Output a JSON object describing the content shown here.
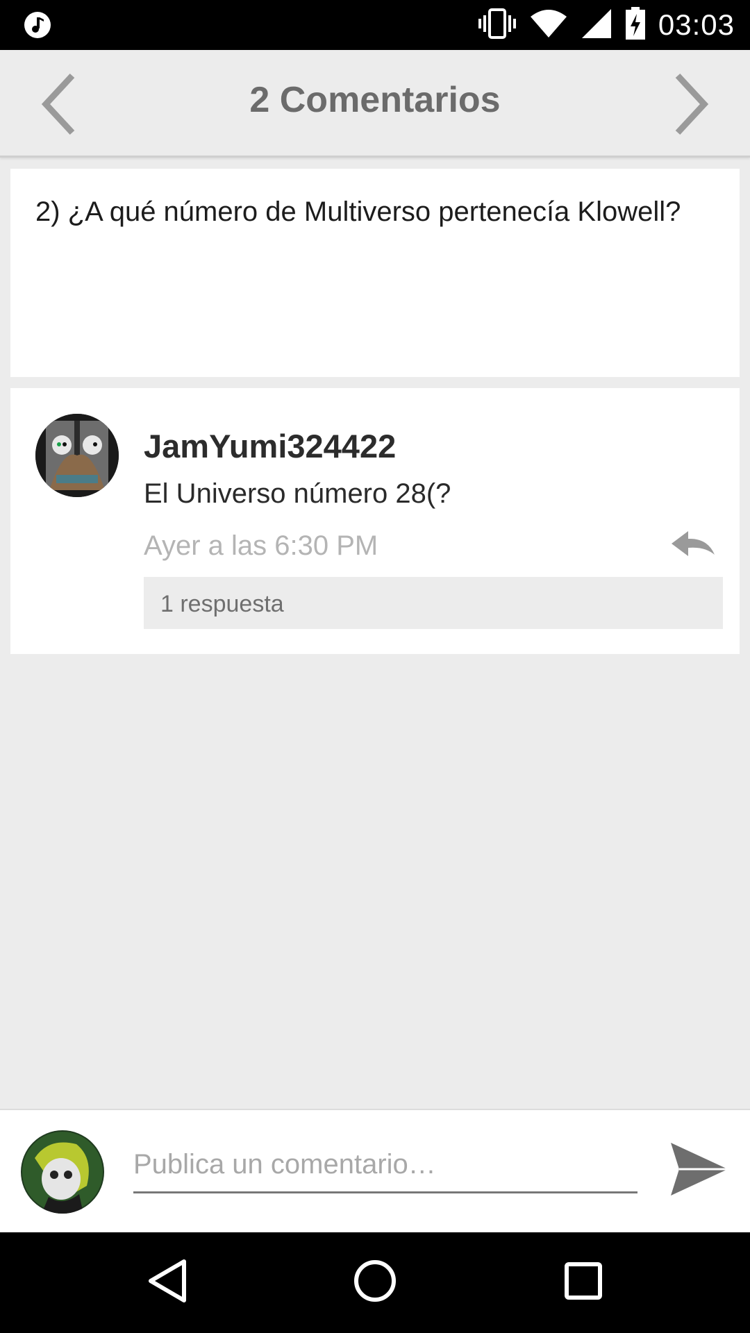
{
  "status_bar": {
    "time": "03:03",
    "icons": [
      "music-note-icon",
      "vibrate-icon",
      "wifi-icon",
      "signal-icon",
      "battery-charging-icon"
    ]
  },
  "app_bar": {
    "title": "2 Comentarios",
    "prev_icon": "chevron-left-icon",
    "next_icon": "chevron-right-icon"
  },
  "post": {
    "text": "2) ¿A qué número de Multiverso pertenecía Klowell?"
  },
  "comments": [
    {
      "username": "JamYumi324422",
      "text": "El Universo número 28(?",
      "time": "Ayer a las 6:30 PM",
      "replies_label": "1 respuesta"
    }
  ],
  "composer": {
    "placeholder": "Publica un comentario…",
    "value": ""
  },
  "colors": {
    "background": "#ececec",
    "title": "#6b6b6b",
    "muted": "#b4b4b4"
  }
}
